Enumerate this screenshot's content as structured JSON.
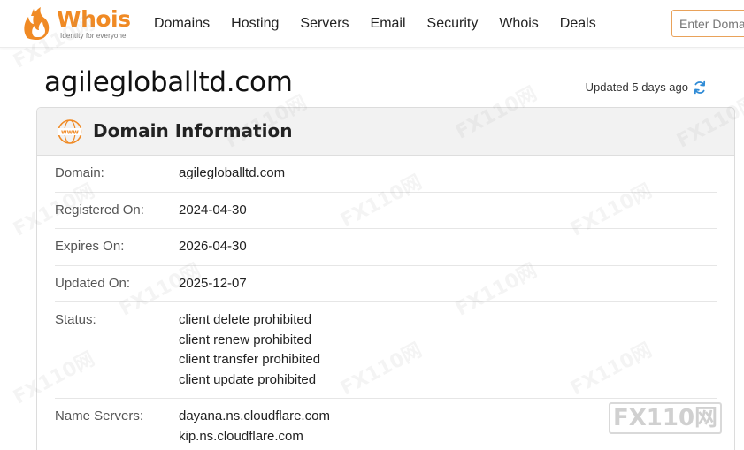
{
  "header": {
    "logo": {
      "word": "Whois",
      "tagline": "Identity for everyone"
    },
    "nav": [
      {
        "label": "Domains",
        "name": "nav-domains"
      },
      {
        "label": "Hosting",
        "name": "nav-hosting"
      },
      {
        "label": "Servers",
        "name": "nav-servers"
      },
      {
        "label": "Email",
        "name": "nav-email"
      },
      {
        "label": "Security",
        "name": "nav-security"
      },
      {
        "label": "Whois",
        "name": "nav-whois"
      },
      {
        "label": "Deals",
        "name": "nav-deals"
      }
    ],
    "search": {
      "placeholder": "Enter Domain"
    }
  },
  "page": {
    "title": "agilegloballtd.com",
    "updated_text": "Updated 5 days ago"
  },
  "card": {
    "title": "Domain Information",
    "rows": [
      {
        "label": "Domain:",
        "values": [
          "agilegloballtd.com"
        ]
      },
      {
        "label": "Registered On:",
        "values": [
          "2024-04-30"
        ]
      },
      {
        "label": "Expires On:",
        "values": [
          "2026-04-30"
        ]
      },
      {
        "label": "Updated On:",
        "values": [
          "2025-12-07"
        ]
      },
      {
        "label": "Status:",
        "values": [
          "client delete prohibited",
          "client renew prohibited",
          "client transfer prohibited",
          "client update prohibited"
        ]
      },
      {
        "label": "Name Servers:",
        "values": [
          "dayana.ns.cloudflare.com",
          "kip.ns.cloudflare.com"
        ]
      }
    ]
  },
  "watermark": {
    "text": "FX110网"
  },
  "colors": {
    "brand": "#f08a24",
    "refresh": "#2f8bd6"
  },
  "icons": {
    "refresh": "refresh-icon",
    "www": "www-globe-icon",
    "logo": "whois-flame-logo-icon"
  }
}
